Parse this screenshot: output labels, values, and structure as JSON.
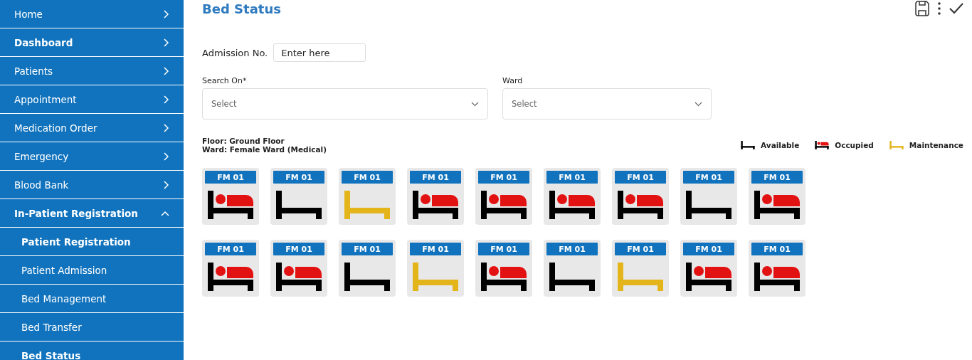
{
  "sidebar": {
    "items": [
      {
        "label": "Home",
        "selected": false,
        "expanded": false
      },
      {
        "label": "Dashboard",
        "selected": true,
        "expanded": false
      },
      {
        "label": "Patients",
        "selected": false,
        "expanded": false
      },
      {
        "label": "Appointment",
        "selected": false,
        "expanded": false
      },
      {
        "label": "Medication Order",
        "selected": false,
        "expanded": false
      },
      {
        "label": "Emergency",
        "selected": false,
        "expanded": false
      },
      {
        "label": "Blood Bank",
        "selected": false,
        "expanded": false
      },
      {
        "label": "In-Patient Registration",
        "selected": true,
        "expanded": true,
        "children": [
          {
            "label": "Patient Registration",
            "selected": true
          },
          {
            "label": "Patient Admission",
            "selected": false
          },
          {
            "label": "Bed Management",
            "selected": false
          },
          {
            "label": "Bed Transfer",
            "selected": false
          },
          {
            "label": "Bed Status",
            "selected": true
          }
        ]
      }
    ]
  },
  "page": {
    "title": "Bed Status"
  },
  "form": {
    "admission_no": {
      "label": "Admission No.",
      "placeholder": "Enter here"
    },
    "search_on": {
      "label": "Search On*",
      "placeholder": "Select"
    },
    "ward": {
      "label": "Ward",
      "placeholder": "Select"
    }
  },
  "info": {
    "floor": "Floor: Ground Floor",
    "ward": "Ward: Female Ward (Medical)"
  },
  "legend": [
    {
      "kind": "available",
      "label": "Available"
    },
    {
      "kind": "occupied",
      "label": "Occupied"
    },
    {
      "kind": "maintenance",
      "label": "Maintenance"
    }
  ],
  "bed_rows": [
    [
      {
        "label": "FM 01",
        "kind": "occupied"
      },
      {
        "label": "FM 01",
        "kind": "available"
      },
      {
        "label": "FM 01",
        "kind": "maintenance"
      },
      {
        "label": "FM 01",
        "kind": "occupied"
      },
      {
        "label": "FM 01",
        "kind": "occupied"
      },
      {
        "label": "FM 01",
        "kind": "occupied"
      },
      {
        "label": "FM 01",
        "kind": "occupied"
      },
      {
        "label": "FM 01",
        "kind": "available"
      },
      {
        "label": "FM 01",
        "kind": "occupied"
      }
    ],
    [
      {
        "label": "FM 01",
        "kind": "occupied"
      },
      {
        "label": "FM 01",
        "kind": "occupied"
      },
      {
        "label": "FM 01",
        "kind": "available"
      },
      {
        "label": "FM 01",
        "kind": "maintenance"
      },
      {
        "label": "FM 01",
        "kind": "occupied"
      },
      {
        "label": "FM 01",
        "kind": "available"
      },
      {
        "label": "FM 01",
        "kind": "maintenance"
      },
      {
        "label": "FM 01",
        "kind": "occupied"
      },
      {
        "label": "FM 01",
        "kind": "occupied"
      }
    ]
  ]
}
